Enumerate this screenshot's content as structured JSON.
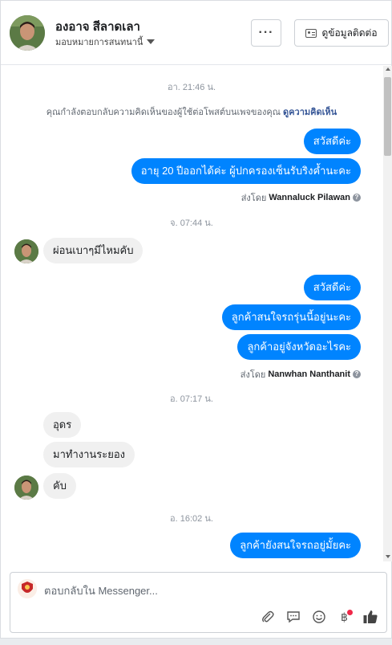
{
  "header": {
    "contact_name": "องอาจ สีลาดเลา",
    "assign_label": "มอบหมายการสนทนานี้",
    "more_label": "···",
    "contact_info_label": "ดูข้อมูลติดต่อ"
  },
  "thread": {
    "timestamp_1": "อา. 21:46 น.",
    "notice_text": "คุณกำลังตอบกลับความคิดเห็นของผู้ใช้ต่อโพสต์บนเพจของคุณ",
    "notice_link": "ดูความคิดเห็น",
    "out_1": "สวัสดีค่ะ",
    "out_2": "อายุ 20 ปีออกได้ค่ะ ผู้ปกครองเซ็นรับริงค้ำนะคะ",
    "sent_by_label_1": "ส่งโดย",
    "sent_by_name_1": "Wannaluck Pilawan",
    "timestamp_2": "จ. 07:44 น.",
    "in_1": "ผ่อนเบาๆมีไหมคับ",
    "out_3": "สวัสดีค่ะ",
    "out_4": "ลูกค้าสนใจรถรุ่นนี้อยู่นะคะ",
    "out_5": "ลูกค้าอยู่จังหวัดอะไรคะ",
    "sent_by_label_2": "ส่งโดย",
    "sent_by_name_2": "Nanwhan Nanthanit",
    "timestamp_3": "อ. 07:17 น.",
    "in_2": "อุดร",
    "in_3": "มาทำงานระยอง",
    "in_4": "คับ",
    "timestamp_4": "อ. 16:02 น.",
    "out_6": "ลูกค้ายังสนใจรถอยู่มั้ยคะ"
  },
  "composer": {
    "placeholder": "ตอบกลับใน Messenger..."
  },
  "colors": {
    "accent": "#0084ff",
    "incoming_bubble": "#f0f0f0",
    "link": "#385898",
    "notification": "#f02849"
  },
  "icons": [
    "more-icon",
    "contact-card-icon",
    "caret-down-icon",
    "info-icon",
    "attachment-icon",
    "saved-reply-icon",
    "emoji-icon",
    "baht-icon",
    "thumbs-up-icon"
  ]
}
